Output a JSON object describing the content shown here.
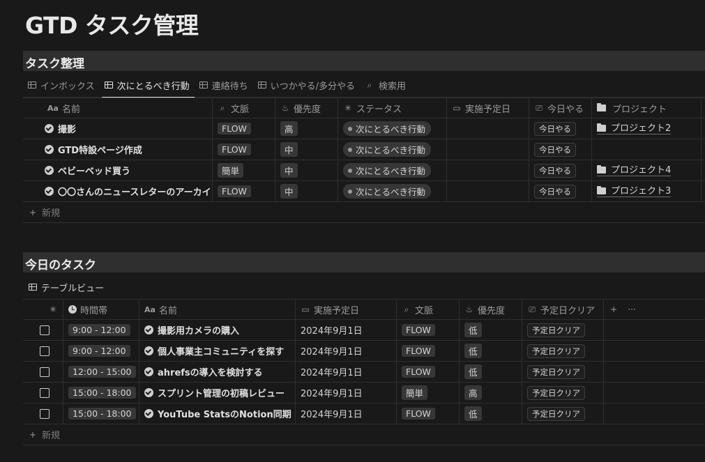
{
  "page": {
    "title": "GTD タスク管理"
  },
  "section1": {
    "title": "タスク整理",
    "tabs": [
      {
        "label": "インボックス",
        "icon": "table-icon"
      },
      {
        "label": "次にとるべき行動",
        "icon": "table-icon",
        "active": true
      },
      {
        "label": "連絡待ち",
        "icon": "table-icon"
      },
      {
        "label": "いつかやる/多分やる",
        "icon": "table-icon"
      },
      {
        "label": "検索用",
        "icon": "search-icon"
      }
    ],
    "columns": [
      "名前",
      "文脈",
      "優先度",
      "ステータス",
      "実施予定日",
      "今日やる",
      "プロジェクト"
    ],
    "rows": [
      {
        "name": "撮影",
        "context": "FLOW",
        "priority": "高",
        "status": "次にとるべき行動",
        "date": "",
        "today": "今日やる",
        "project": "プロジェクト2"
      },
      {
        "name": "GTD特設ページ作成",
        "context": "FLOW",
        "priority": "中",
        "status": "次にとるべき行動",
        "date": "",
        "today": "今日やる",
        "project": ""
      },
      {
        "name": "ベビーベッド買う",
        "context": "簡単",
        "priority": "中",
        "status": "次にとるべき行動",
        "date": "",
        "today": "今日やる",
        "project": "プロジェクト4"
      },
      {
        "name": "〇〇さんのニュースレターのアーカイブ",
        "context": "FLOW",
        "priority": "中",
        "status": "次にとるべき行動",
        "date": "",
        "today": "今日やる",
        "project": "プロジェクト3"
      }
    ],
    "new_label": "新規"
  },
  "section2": {
    "title": "今日のタスク",
    "view_label": "テーブルビュー",
    "columns": [
      "時間帯",
      "名前",
      "実施予定日",
      "文脈",
      "優先度",
      "予定日クリア"
    ],
    "add_label": "+",
    "more_label": "···",
    "rows": [
      {
        "time": "9:00 - 12:00",
        "name": "撮影用カメラの購入",
        "date": "2024年9月1日",
        "context": "FLOW",
        "priority": "低",
        "clear": "予定日クリア"
      },
      {
        "time": "9:00 - 12:00",
        "name": "個人事業主コミュニティを探す",
        "date": "2024年9月1日",
        "context": "FLOW",
        "priority": "低",
        "clear": "予定日クリア"
      },
      {
        "time": "12:00 - 15:00",
        "name": "ahrefsの導入を検討する",
        "date": "2024年9月1日",
        "context": "FLOW",
        "priority": "低",
        "clear": "予定日クリア"
      },
      {
        "time": "15:00 - 18:00",
        "name": "スプリント管理の初稿レビュー",
        "date": "2024年9月1日",
        "context": "簡単",
        "priority": "高",
        "clear": "予定日クリア"
      },
      {
        "time": "15:00 - 18:00",
        "name": "YouTube StatsのNotion同期",
        "date": "2024年9月1日",
        "context": "FLOW",
        "priority": "低",
        "clear": "予定日クリア"
      }
    ],
    "new_label": "新規"
  }
}
